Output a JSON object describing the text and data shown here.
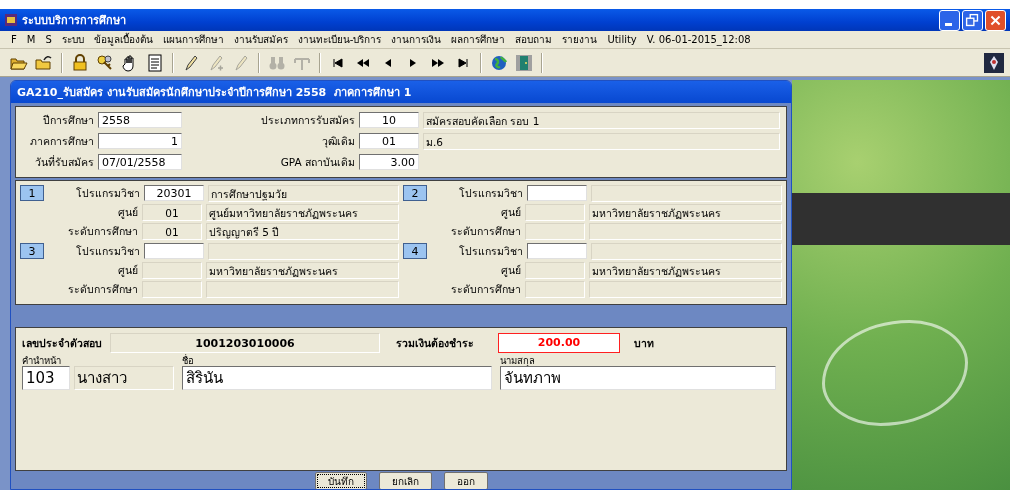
{
  "window": {
    "title": "ระบบบริการการศึกษา"
  },
  "menu": [
    "F",
    "M",
    "S",
    "ระบบ",
    "ข้อมูลเบื้องต้น",
    "แผนการศึกษา",
    "งานรับสมัคร",
    "งานทะเบียน-บริการ",
    "งานการเงิน",
    "ผลการศึกษา",
    "สอบถาม",
    "รายงาน",
    "Utility",
    "V. 06-01-2015_12:08"
  ],
  "toolbar": [
    {
      "kind": "open-folder",
      "disabled": false
    },
    {
      "kind": "folder-arrow",
      "disabled": false
    },
    {
      "kind": "lock",
      "disabled": false
    },
    {
      "kind": "keys",
      "disabled": false
    },
    {
      "kind": "hand",
      "disabled": false
    },
    {
      "kind": "document",
      "disabled": false
    },
    {
      "kind": "pencil",
      "disabled": false
    },
    {
      "kind": "pencil-plus",
      "disabled": true
    },
    {
      "kind": "pencil",
      "disabled": true
    },
    {
      "kind": "binoculars",
      "disabled": true
    },
    {
      "kind": "tool",
      "disabled": true
    },
    {
      "kind": "first",
      "disabled": false
    },
    {
      "kind": "rewind",
      "disabled": false
    },
    {
      "kind": "prev",
      "disabled": false
    },
    {
      "kind": "next",
      "disabled": false
    },
    {
      "kind": "forward",
      "disabled": false
    },
    {
      "kind": "last",
      "disabled": false
    },
    {
      "kind": "globe",
      "disabled": false
    },
    {
      "kind": "door",
      "disabled": false
    }
  ],
  "form": {
    "title": "GA210_รับสมัคร งานรับสมัครนักศึกษาประจำปีการศึกษา 2558  ภาคการศึกษา 1",
    "left_fields": [
      {
        "label": "ปีการศึกษา",
        "value": "2558",
        "kind": "text"
      },
      {
        "label": "ภาคการศึกษา",
        "value": "1",
        "kind": "number"
      },
      {
        "label": "วันที่รับสมัคร",
        "value": "07/01/2558",
        "kind": "text"
      }
    ],
    "right_fields": [
      {
        "label": "ประเภทการรับสมัคร",
        "value": "10",
        "kind": "code",
        "description": "สมัครสอบคัดเลือก รอบ 1"
      },
      {
        "label": "วุฒิเดิม",
        "value": "01",
        "kind": "code",
        "description": "ม.6"
      },
      {
        "label": "GPA สถาบันเดิม",
        "value": "3.00",
        "kind": "number"
      }
    ],
    "programs": [
      {
        "number": "1",
        "program_label": "โปรแกรมวิชา",
        "program_code": "20301",
        "program_name": "การศึกษาปฐมวัย",
        "center_label": "ศูนย์",
        "center_code": "01",
        "center_name": "ศูนย์มหาวิทยาลัยราชภัฏพระนคร",
        "level_label": "ระดับการศึกษา",
        "level_code": "01",
        "level_name": "ปริญญาตรี 5 ปี"
      },
      {
        "number": "2",
        "program_label": "โปรแกรมวิชา",
        "center_label": "ศูนย์",
        "center_name": "มหาวิทยาลัยราชภัฏพระนคร",
        "level_label": "ระดับการศึกษา"
      },
      {
        "number": "3",
        "program_label": "โปรแกรมวิชา",
        "center_label": "ศูนย์",
        "center_name": "มหาวิทยาลัยราชภัฏพระนคร",
        "level_label": "ระดับการศึกษา"
      },
      {
        "number": "4",
        "program_label": "โปรแกรมวิชา",
        "center_label": "ศูนย์",
        "center_name": "มหาวิทยาลัยราชภัฏพระนคร",
        "level_label": "ระดับการศึกษา"
      }
    ],
    "exam_id_label": "เลขประจำตัวสอบ",
    "exam_id": "1001203010006",
    "total_label": "รวมเงินต้องชำระ",
    "total": "200.00",
    "currency": "บาท",
    "prefix_label": "คำนำหน้า",
    "prefix_code": "103",
    "prefix": "นางสาว",
    "first_name_label": "ชื่อ",
    "first_name": "สิรินัน",
    "last_name_label": "นามสกุล",
    "last_name": "จันทภาพ"
  },
  "buttons": [
    {
      "label": "บันทึก",
      "focused": true
    },
    {
      "label": "ยกเลิก",
      "focused": false
    },
    {
      "label": "ออก",
      "focused": false
    }
  ]
}
